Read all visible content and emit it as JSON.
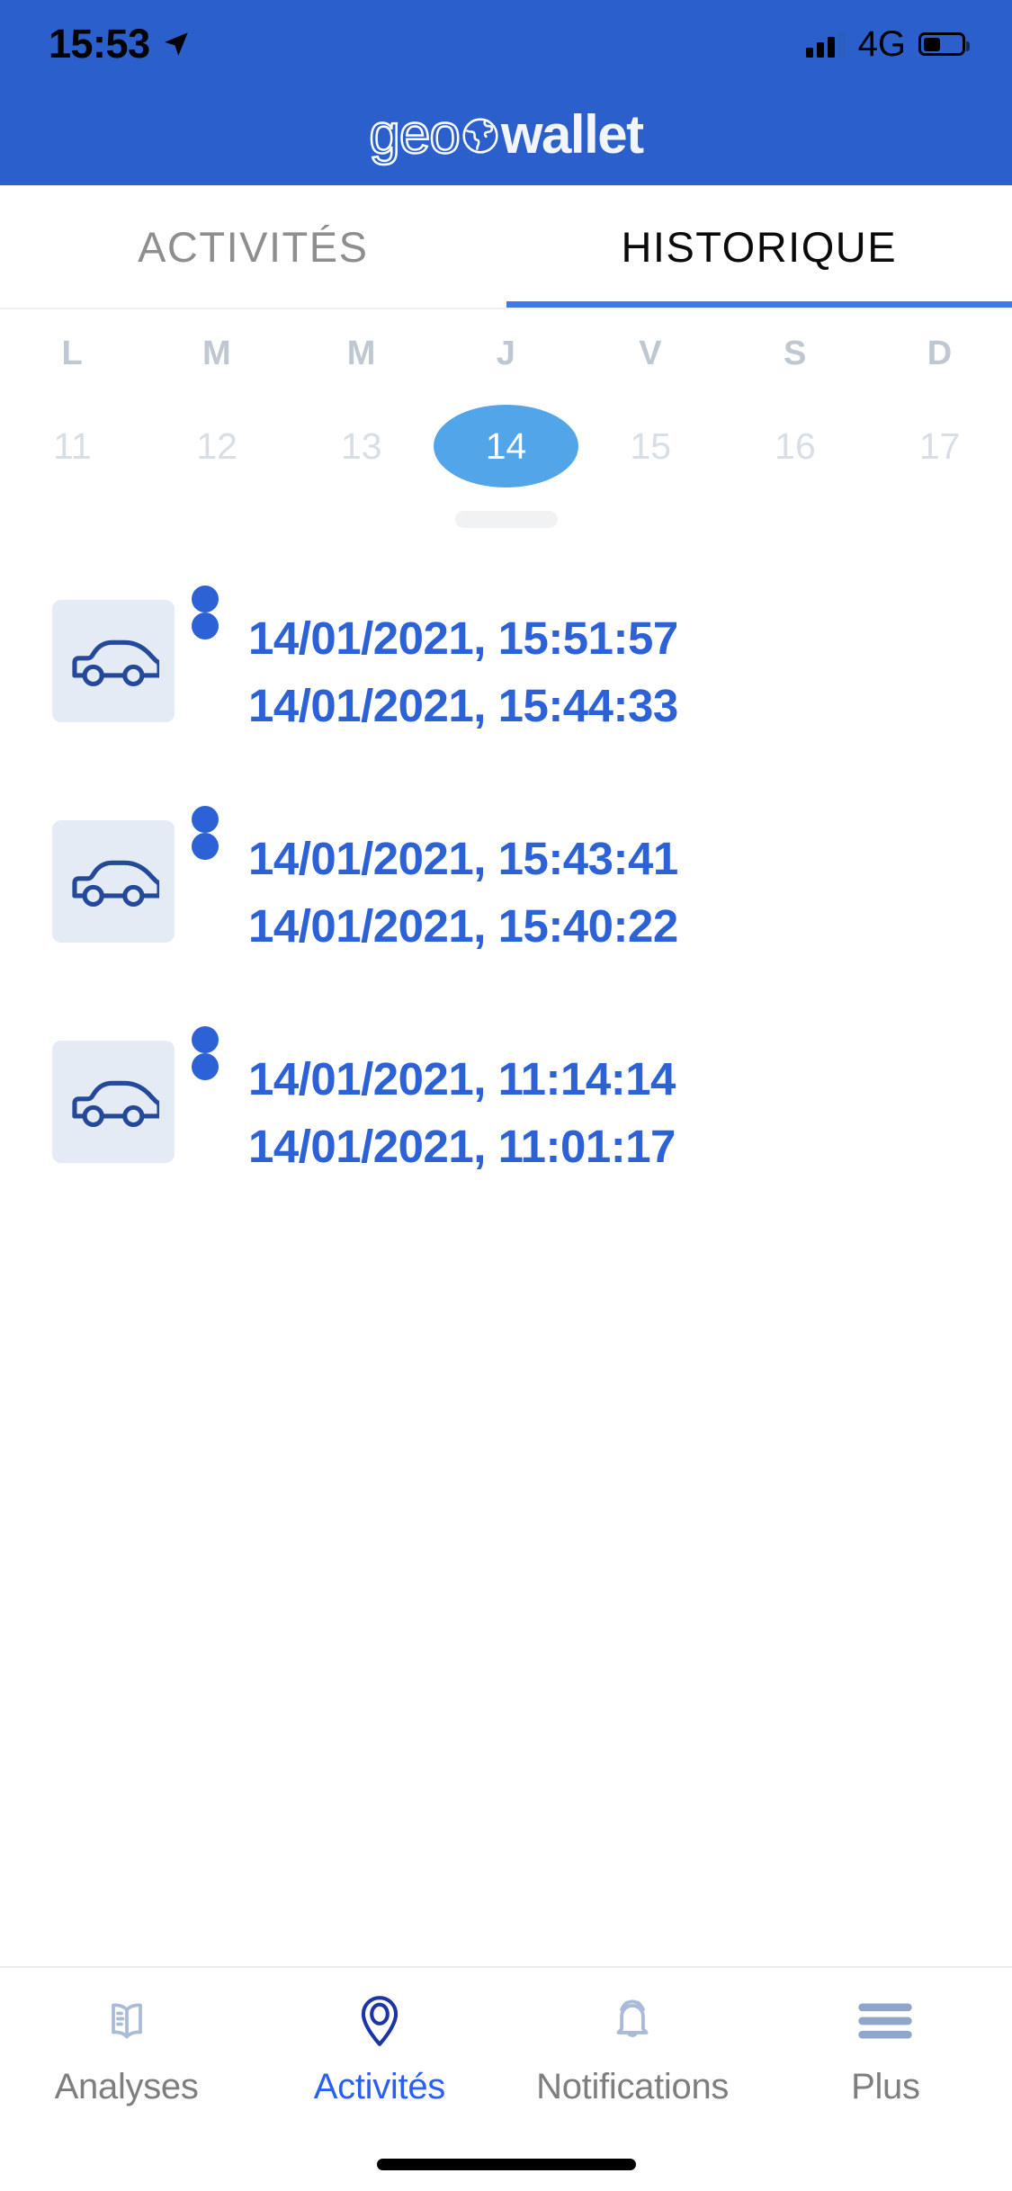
{
  "status_bar": {
    "time": "15:53",
    "location_icon": "location-arrow-icon",
    "signal_icon": "cellular-bars-icon",
    "network": "4G",
    "battery_icon": "battery-icon"
  },
  "app_header": {
    "logo_part1": "geo",
    "logo_globe_icon": "globe-icon",
    "logo_part2": "wallet",
    "brand_color": "#2A5FCC"
  },
  "tabs": {
    "items": [
      {
        "label": "ACTIVITÉS",
        "active": false
      },
      {
        "label": "HISTORIQUE",
        "active": true
      }
    ],
    "indicator_color": "#3B79F0"
  },
  "calendar": {
    "day_labels": [
      "L",
      "M",
      "M",
      "J",
      "V",
      "S",
      "D"
    ],
    "dates": [
      "11",
      "12",
      "13",
      "14",
      "15",
      "16",
      "17"
    ],
    "selected_date": "14",
    "selected_color": "#52A5E8",
    "handle_icon": "drag-handle"
  },
  "trips": [
    {
      "icon": "car-icon",
      "end_time": "14/01/2021, 15:51:57",
      "start_time": "14/01/2021, 15:44:33"
    },
    {
      "icon": "car-icon",
      "end_time": "14/01/2021, 15:43:41",
      "start_time": "14/01/2021, 15:40:22"
    },
    {
      "icon": "car-icon",
      "end_time": "14/01/2021, 11:14:14",
      "start_time": "14/01/2021, 11:01:17"
    }
  ],
  "bottom_nav": {
    "items": [
      {
        "label": "Analyses",
        "icon": "book-icon",
        "active": false
      },
      {
        "label": "Activités",
        "icon": "location-pin-icon",
        "active": true
      },
      {
        "label": "Notifications",
        "icon": "bell-icon",
        "active": false
      },
      {
        "label": "Plus",
        "icon": "hamburger-menu-icon",
        "active": false
      }
    ],
    "active_color": "#2A5FF0",
    "inactive_color": "#7E7E7E"
  }
}
